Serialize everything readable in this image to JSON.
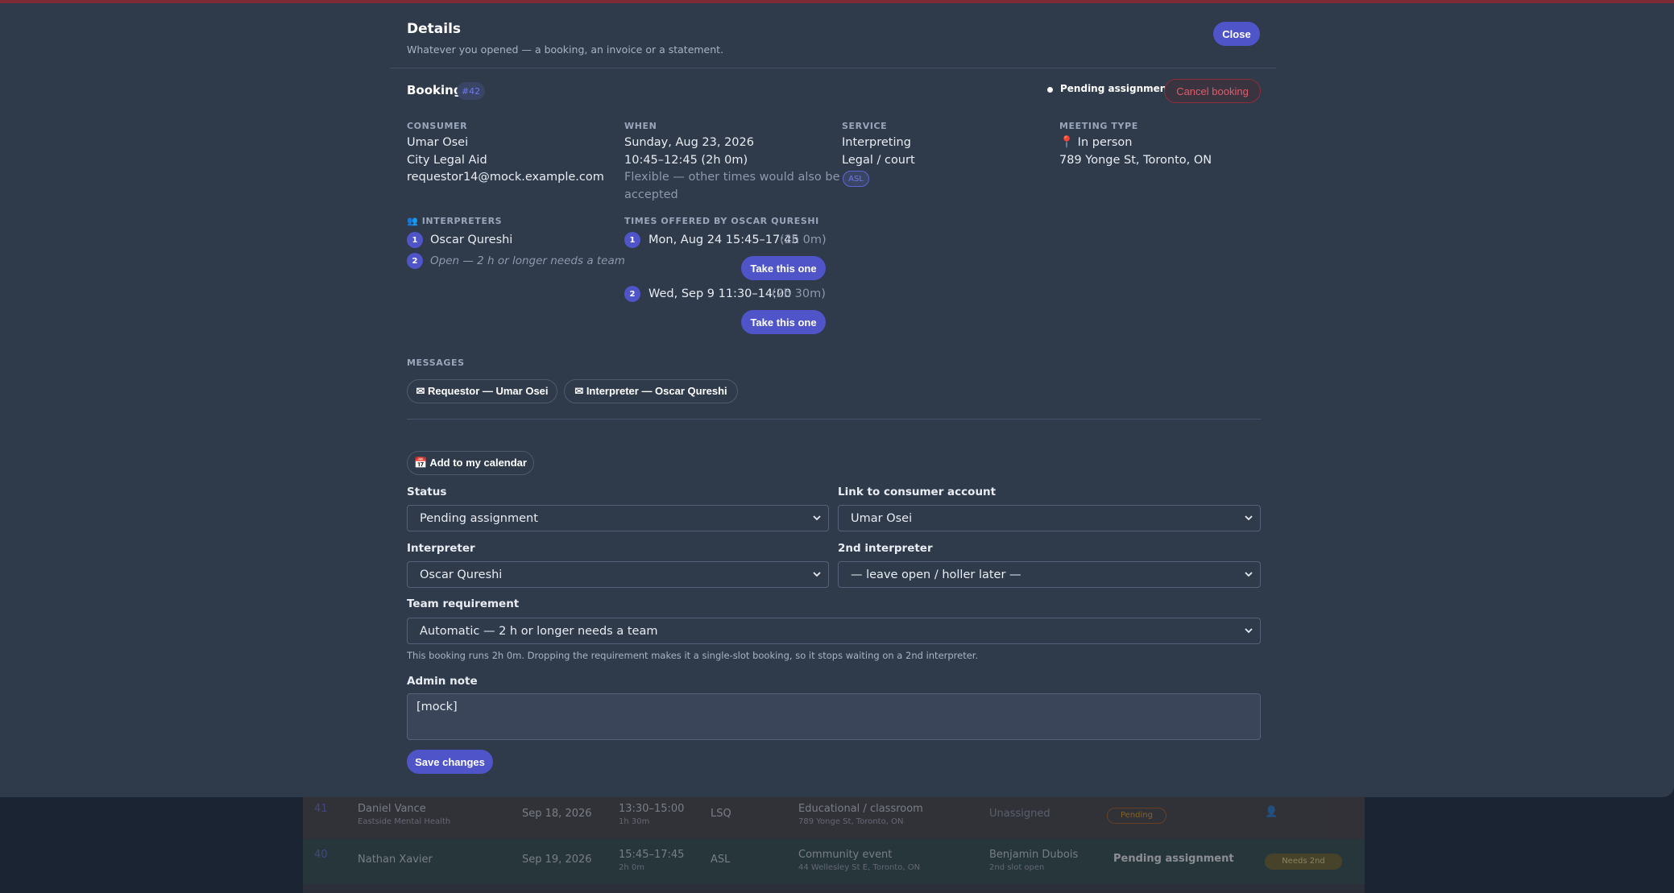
{
  "dialog": {
    "title": "Details",
    "subtitle": "Whatever you opened — a booking, an invoice or a statement.",
    "close_label": "Close"
  },
  "booking": {
    "heading": "Booking",
    "id": "#42",
    "status": "Pending assignment",
    "cancel_label": "Cancel booking",
    "consumer": {
      "label": "CONSUMER",
      "name": "Umar Osei",
      "org": "City Legal Aid",
      "email": "requestor14@mock.example.com"
    },
    "when": {
      "label": "WHEN",
      "date": "Sunday, Aug 23, 2026",
      "time": "10:45–12:45 (2h 0m)",
      "flex_line1": "Flexible — other times would also be",
      "flex_line2": "accepted"
    },
    "service": {
      "label": "SERVICE",
      "type": "Interpreting",
      "category": "Legal / court",
      "language": "ASL"
    },
    "meeting": {
      "label": "MEETING TYPE",
      "type": "📍 In person",
      "address": "789 Yonge St, Toronto, ON"
    },
    "interpreters": {
      "label": "👥 INTERPRETERS",
      "items": [
        {
          "n": "1",
          "text": "Oscar Qureshi"
        },
        {
          "n": "2",
          "text": "Open — 2 h or longer needs a team"
        }
      ]
    },
    "offered": {
      "label": "TIMES OFFERED BY OSCAR QURESHI",
      "items": [
        {
          "n": "1",
          "time": "Mon, Aug 24 15:45–17:45",
          "dur": "(2h 0m)",
          "btn": "Take this one"
        },
        {
          "n": "2",
          "time": "Wed, Sep 9 11:30–14:00",
          "dur": "(2h 30m)",
          "btn": "Take this one"
        }
      ]
    },
    "messages": {
      "label": "MESSAGES",
      "threads": [
        "✉ Requestor — Umar Osei",
        "✉ Interpreter — Oscar Qureshi"
      ]
    }
  },
  "form": {
    "calendar_label": "📅 Add to my calendar",
    "status_label": "Status",
    "status_value": "Pending assignment",
    "consumer_link_label": "Link to consumer account",
    "consumer_link_value": "Umar Osei",
    "interpreter_label": "Interpreter",
    "interpreter_value": "Oscar Qureshi",
    "second_interpreter_label": "2nd interpreter",
    "second_interpreter_value": "— leave open / holler later —",
    "team_label": "Team requirement",
    "team_value": "Automatic — 2 h or longer needs a team",
    "team_hint": "This booking runs 2h 0m. Dropping the requirement makes it a single-slot booking, so it stops waiting on a 2nd interpreter.",
    "admin_note_label": "Admin note",
    "admin_note_value": "[mock]",
    "save_label": "Save changes"
  },
  "background_rows": [
    {
      "id": "41",
      "name": "Daniel Vance",
      "org": "Eastside Mental Health",
      "date": "Sep 18, 2026",
      "time": "13:30–15:00",
      "dur": "1h 30m",
      "lang": "LSQ",
      "category": "Educational / classroom",
      "addr": "789 Yonge St, Toronto, ON",
      "interp": "Unassigned",
      "status": "Pending"
    },
    {
      "id": "40",
      "name": "Nathan Xavier",
      "date": "Sep 19, 2026",
      "time": "15:45–17:45",
      "dur": "2h 0m",
      "lang": "ASL",
      "category": "Community event",
      "addr": "44 Wellesley St E, Toronto, ON",
      "interp": "Benjamin Dubois",
      "interp2": "2nd slot open",
      "status": "Pending assignment",
      "badge": "Needs 2nd"
    }
  ]
}
